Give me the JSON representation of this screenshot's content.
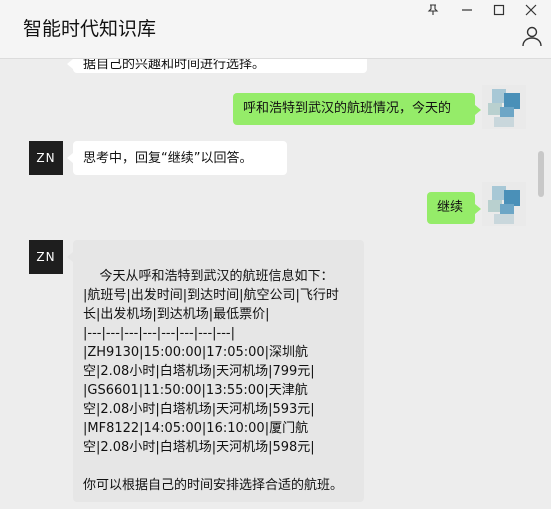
{
  "window": {
    "title": "智能时代知识库",
    "controls": {
      "pin": "⊥",
      "minimize": "—",
      "maximize": "☐",
      "close": "✕"
    }
  },
  "messages": {
    "m0": {
      "text": "据自己的兴趣和时间进行选择。"
    },
    "m1": {
      "text": "呼和浩特到武汉的航班情况，今天的"
    },
    "m2": {
      "avatar": "ZN",
      "text": "思考中，回复“继续”以回答。"
    },
    "m3": {
      "text": "继续"
    },
    "m4": {
      "avatar": "ZN",
      "text": "今天从呼和浩特到武汉的航班信息如下：\n|航班号|出发时间|到达时间|航空公司|飞行时长|出发机场|到达机场|最低票价|\n|---|---|---|---|---|---|---|---|\n|ZH9130|15:00:00|17:05:00|深圳航空|2.08小时|白塔机场|天河机场|799元|\n|GS6601|11:50:00|13:55:00|天津航空|2.08小时|白塔机场|天河机场|593元|\n|MF8122|14:05:00|16:10:00|厦门航空|2.08小时|白塔机场|天河机场|598元|\n\n你可以根据自己的时间安排选择合适的航班。"
    }
  },
  "colors": {
    "green_bubble": "#95ec69",
    "background": "#ededed",
    "avatar_dark": "#1e1e1e"
  },
  "icons": [
    "pin-icon",
    "minimize-icon",
    "maximize-icon",
    "close-icon",
    "person-icon"
  ]
}
